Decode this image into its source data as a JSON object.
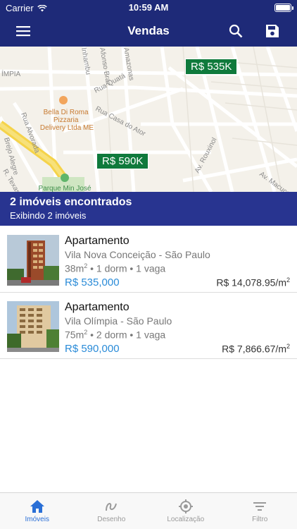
{
  "status_bar": {
    "carrier": "Carrier",
    "time": "10:59 AM"
  },
  "nav": {
    "title": "Vendas",
    "menu_icon": "menu-icon",
    "search_icon": "search-icon",
    "save_icon": "save-icon"
  },
  "map": {
    "markers": [
      {
        "label": "R$ 535K"
      },
      {
        "label": "R$ 590K"
      }
    ],
    "labels": {
      "street1": "Rua Quatá",
      "street2": "Rua Casa do Ator",
      "street3": "Av. Rouxinol",
      "street4": "Av. Macuco",
      "street5": "Rua Alvorada",
      "street6": "Brejo Alegre",
      "street7": "R. Texas",
      "street8": "Afonso Braz",
      "street9": "Amazonas",
      "street10": "Inhambu",
      "poi": "Bella Di Roma Pizzaria Delivery Ltda ME",
      "park": "Parque Min José",
      "district": "ÍMPIA"
    }
  },
  "results": {
    "count_text": "2 imóveis encontrados",
    "showing_text": "Exibindo 2 imóveis"
  },
  "listings": [
    {
      "type": "Apartamento",
      "location": "Vila Nova Conceição - São Paulo",
      "area": "38m",
      "details": " • 1 dorm • 1 vaga",
      "price": "R$ 535,000",
      "ppsqm": "R$ 14,078.95/m"
    },
    {
      "type": "Apartamento",
      "location": "Vila Olímpia - São Paulo",
      "area": "75m",
      "details": " • 2 dorm • 1 vaga",
      "price": "R$ 590,000",
      "ppsqm": "R$ 7,866.67/m"
    }
  ],
  "tabs": [
    {
      "label": "Imóveis",
      "icon": "home-icon",
      "active": true
    },
    {
      "label": "Desenho",
      "icon": "draw-icon",
      "active": false
    },
    {
      "label": "Localização",
      "icon": "location-icon",
      "active": false
    },
    {
      "label": "Filtro",
      "icon": "filter-icon",
      "active": false
    }
  ],
  "colors": {
    "primary": "#1e2a78",
    "header": "#283490",
    "marker": "#0f7a3c",
    "price": "#2a8bd8",
    "tab_active": "#2a6fd6"
  }
}
